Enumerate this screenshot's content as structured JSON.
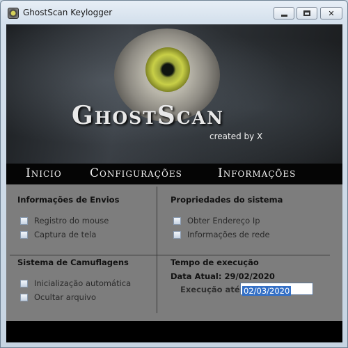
{
  "window": {
    "title": "GhostScan Keylogger"
  },
  "banner": {
    "logo": "GhostScan",
    "byline": "created by X"
  },
  "menu": [
    "Inicio",
    "Configurações",
    "Informações"
  ],
  "sections": {
    "envios": {
      "title": "Informações de Envios",
      "options": [
        "Registro do mouse",
        "Captura de tela"
      ]
    },
    "sistema": {
      "title": "Propriedades do sistema",
      "options": [
        "Obter Endereço Ip",
        "Informações de rede"
      ]
    },
    "camuflagens": {
      "title": "Sistema de Camuflagens",
      "options": [
        "Inicialização automática",
        "Ocultar arquivo"
      ]
    },
    "execucao": {
      "title": "Tempo de execução",
      "data_atual": "Data Atual: 29/02/2020",
      "ate_label": "Execução até:",
      "ate_value": "02/03/2020"
    }
  },
  "colors": {
    "panel": "#7d7d7d",
    "selection": "#3470c6",
    "eye_iris": "#c8cf47"
  }
}
